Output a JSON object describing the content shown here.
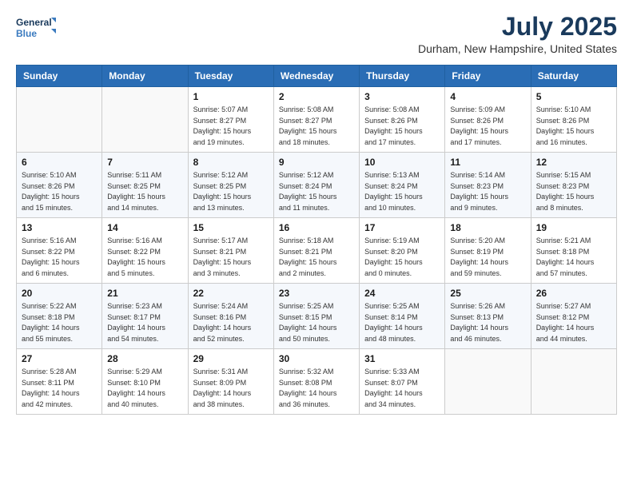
{
  "header": {
    "logo_line1": "General",
    "logo_line2": "Blue",
    "month_title": "July 2025",
    "location": "Durham, New Hampshire, United States"
  },
  "weekdays": [
    "Sunday",
    "Monday",
    "Tuesday",
    "Wednesday",
    "Thursday",
    "Friday",
    "Saturday"
  ],
  "weeks": [
    [
      {
        "day": "",
        "info": ""
      },
      {
        "day": "",
        "info": ""
      },
      {
        "day": "1",
        "info": "Sunrise: 5:07 AM\nSunset: 8:27 PM\nDaylight: 15 hours\nand 19 minutes."
      },
      {
        "day": "2",
        "info": "Sunrise: 5:08 AM\nSunset: 8:27 PM\nDaylight: 15 hours\nand 18 minutes."
      },
      {
        "day": "3",
        "info": "Sunrise: 5:08 AM\nSunset: 8:26 PM\nDaylight: 15 hours\nand 17 minutes."
      },
      {
        "day": "4",
        "info": "Sunrise: 5:09 AM\nSunset: 8:26 PM\nDaylight: 15 hours\nand 17 minutes."
      },
      {
        "day": "5",
        "info": "Sunrise: 5:10 AM\nSunset: 8:26 PM\nDaylight: 15 hours\nand 16 minutes."
      }
    ],
    [
      {
        "day": "6",
        "info": "Sunrise: 5:10 AM\nSunset: 8:26 PM\nDaylight: 15 hours\nand 15 minutes."
      },
      {
        "day": "7",
        "info": "Sunrise: 5:11 AM\nSunset: 8:25 PM\nDaylight: 15 hours\nand 14 minutes."
      },
      {
        "day": "8",
        "info": "Sunrise: 5:12 AM\nSunset: 8:25 PM\nDaylight: 15 hours\nand 13 minutes."
      },
      {
        "day": "9",
        "info": "Sunrise: 5:12 AM\nSunset: 8:24 PM\nDaylight: 15 hours\nand 11 minutes."
      },
      {
        "day": "10",
        "info": "Sunrise: 5:13 AM\nSunset: 8:24 PM\nDaylight: 15 hours\nand 10 minutes."
      },
      {
        "day": "11",
        "info": "Sunrise: 5:14 AM\nSunset: 8:23 PM\nDaylight: 15 hours\nand 9 minutes."
      },
      {
        "day": "12",
        "info": "Sunrise: 5:15 AM\nSunset: 8:23 PM\nDaylight: 15 hours\nand 8 minutes."
      }
    ],
    [
      {
        "day": "13",
        "info": "Sunrise: 5:16 AM\nSunset: 8:22 PM\nDaylight: 15 hours\nand 6 minutes."
      },
      {
        "day": "14",
        "info": "Sunrise: 5:16 AM\nSunset: 8:22 PM\nDaylight: 15 hours\nand 5 minutes."
      },
      {
        "day": "15",
        "info": "Sunrise: 5:17 AM\nSunset: 8:21 PM\nDaylight: 15 hours\nand 3 minutes."
      },
      {
        "day": "16",
        "info": "Sunrise: 5:18 AM\nSunset: 8:21 PM\nDaylight: 15 hours\nand 2 minutes."
      },
      {
        "day": "17",
        "info": "Sunrise: 5:19 AM\nSunset: 8:20 PM\nDaylight: 15 hours\nand 0 minutes."
      },
      {
        "day": "18",
        "info": "Sunrise: 5:20 AM\nSunset: 8:19 PM\nDaylight: 14 hours\nand 59 minutes."
      },
      {
        "day": "19",
        "info": "Sunrise: 5:21 AM\nSunset: 8:18 PM\nDaylight: 14 hours\nand 57 minutes."
      }
    ],
    [
      {
        "day": "20",
        "info": "Sunrise: 5:22 AM\nSunset: 8:18 PM\nDaylight: 14 hours\nand 55 minutes."
      },
      {
        "day": "21",
        "info": "Sunrise: 5:23 AM\nSunset: 8:17 PM\nDaylight: 14 hours\nand 54 minutes."
      },
      {
        "day": "22",
        "info": "Sunrise: 5:24 AM\nSunset: 8:16 PM\nDaylight: 14 hours\nand 52 minutes."
      },
      {
        "day": "23",
        "info": "Sunrise: 5:25 AM\nSunset: 8:15 PM\nDaylight: 14 hours\nand 50 minutes."
      },
      {
        "day": "24",
        "info": "Sunrise: 5:25 AM\nSunset: 8:14 PM\nDaylight: 14 hours\nand 48 minutes."
      },
      {
        "day": "25",
        "info": "Sunrise: 5:26 AM\nSunset: 8:13 PM\nDaylight: 14 hours\nand 46 minutes."
      },
      {
        "day": "26",
        "info": "Sunrise: 5:27 AM\nSunset: 8:12 PM\nDaylight: 14 hours\nand 44 minutes."
      }
    ],
    [
      {
        "day": "27",
        "info": "Sunrise: 5:28 AM\nSunset: 8:11 PM\nDaylight: 14 hours\nand 42 minutes."
      },
      {
        "day": "28",
        "info": "Sunrise: 5:29 AM\nSunset: 8:10 PM\nDaylight: 14 hours\nand 40 minutes."
      },
      {
        "day": "29",
        "info": "Sunrise: 5:31 AM\nSunset: 8:09 PM\nDaylight: 14 hours\nand 38 minutes."
      },
      {
        "day": "30",
        "info": "Sunrise: 5:32 AM\nSunset: 8:08 PM\nDaylight: 14 hours\nand 36 minutes."
      },
      {
        "day": "31",
        "info": "Sunrise: 5:33 AM\nSunset: 8:07 PM\nDaylight: 14 hours\nand 34 minutes."
      },
      {
        "day": "",
        "info": ""
      },
      {
        "day": "",
        "info": ""
      }
    ]
  ]
}
